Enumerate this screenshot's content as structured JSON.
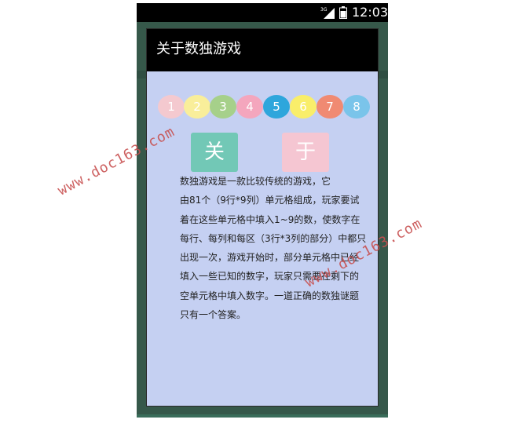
{
  "status_bar": {
    "network": "3G",
    "time": "12:03"
  },
  "dialog": {
    "title": "关于数独游戏",
    "circles": [
      {
        "label": "1",
        "color": "#f4c9cf"
      },
      {
        "label": "2",
        "color": "#f9ee9a"
      },
      {
        "label": "3",
        "color": "#a6d08a"
      },
      {
        "label": "4",
        "color": "#f4a6bd"
      },
      {
        "label": "5",
        "color": "#2ea6dc"
      },
      {
        "label": "6",
        "color": "#f9ee6a"
      },
      {
        "label": "7",
        "color": "#f08a72"
      },
      {
        "label": "8",
        "color": "#7ac4ea"
      }
    ],
    "tiles": [
      {
        "label": "关",
        "color": "#72c8b6"
      },
      {
        "label": "于",
        "color": "#f5c6d2"
      }
    ],
    "description_lines": [
      "数独游戏是一款比较传统的游戏，它",
      "由81个（9行*9列）单元格组成，玩家要试",
      "着在这些单元格中填入1~9的数，使数字在",
      "每行、每列和每区（3行*3列的部分）中都只",
      "出现一次，游戏开始时，部分单元格中已经",
      "填入一些已知的数字，玩家只需要在剩下的",
      "空单元格中填入数字。一道正确的数独谜题",
      "只有一个答案。"
    ]
  },
  "watermarks": [
    "www.doc163.com",
    "www.doc163.com"
  ]
}
